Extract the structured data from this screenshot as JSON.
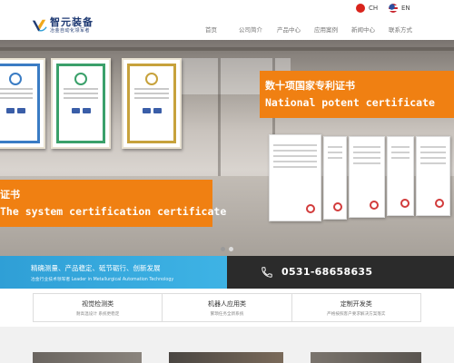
{
  "language": {
    "cn_label": "CH",
    "en_label": "EN"
  },
  "header": {
    "logo_title": "智元装备",
    "logo_subtitle": "冶金自动化领军者"
  },
  "nav": {
    "items": [
      "首页",
      "公司简介",
      "产品中心",
      "应用案例",
      "新闻中心",
      "联系方式"
    ]
  },
  "banner": {
    "right_cn": "数十项国家专利证书",
    "right_en": "National potent certificate",
    "left_cn": "证书",
    "left_en": "The system certification certificate",
    "accent_color": "#f08012",
    "slides": [
      true,
      false
    ]
  },
  "strip": {
    "title": "精确测量、产品稳定、砥节砺行、创新发展",
    "subtitle": "冶金行业技术领军者 Leader in Metallurgical Automation Technology",
    "phone": "0531-68658635",
    "left_color": "#2f9fd6",
    "right_color": "#2b2b2b"
  },
  "services": [
    {
      "title": "视觉检测类",
      "desc": "耐高温设计 系统更稳定"
    },
    {
      "title": "机器人应用类",
      "desc": "繁琐任务全新系统"
    },
    {
      "title": "定制开发类",
      "desc": "严格按照客户要求解决方案落实"
    }
  ],
  "icons": {
    "phone": "phone-icon",
    "logo": "logo-mark-icon"
  }
}
